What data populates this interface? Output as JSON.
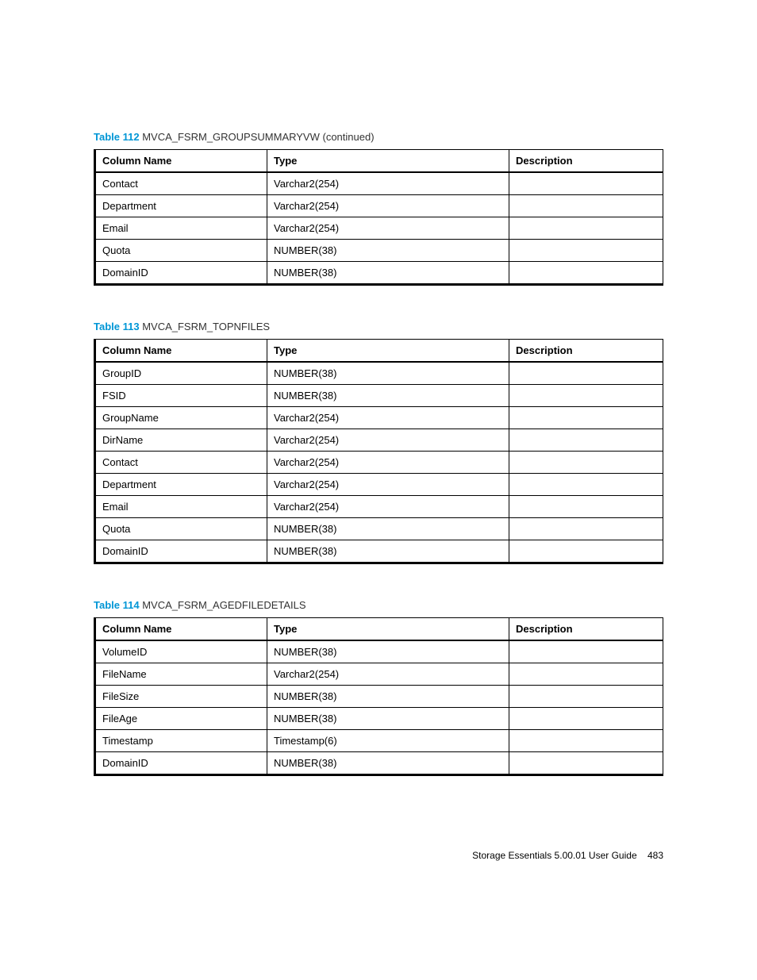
{
  "tables": [
    {
      "number": "Table 112",
      "title": "MVCA_FSRM_GROUPSUMMARYVW (continued)",
      "headers": {
        "col1": "Column Name",
        "col2": "Type",
        "col3": "Description"
      },
      "rows": [
        {
          "name": "Contact",
          "type": "Varchar2(254)",
          "desc": ""
        },
        {
          "name": "Department",
          "type": "Varchar2(254)",
          "desc": ""
        },
        {
          "name": "Email",
          "type": "Varchar2(254)",
          "desc": ""
        },
        {
          "name": "Quota",
          "type": "NUMBER(38)",
          "desc": ""
        },
        {
          "name": "DomainID",
          "type": "NUMBER(38)",
          "desc": ""
        }
      ]
    },
    {
      "number": "Table 113",
      "title": "MVCA_FSRM_TOPNFILES",
      "headers": {
        "col1": "Column Name",
        "col2": "Type",
        "col3": "Description"
      },
      "rows": [
        {
          "name": "GroupID",
          "type": "NUMBER(38)",
          "desc": ""
        },
        {
          "name": "FSID",
          "type": "NUMBER(38)",
          "desc": ""
        },
        {
          "name": "GroupName",
          "type": "Varchar2(254)",
          "desc": ""
        },
        {
          "name": "DirName",
          "type": "Varchar2(254)",
          "desc": ""
        },
        {
          "name": "Contact",
          "type": "Varchar2(254)",
          "desc": ""
        },
        {
          "name": "Department",
          "type": "Varchar2(254)",
          "desc": ""
        },
        {
          "name": "Email",
          "type": "Varchar2(254)",
          "desc": ""
        },
        {
          "name": "Quota",
          "type": "NUMBER(38)",
          "desc": ""
        },
        {
          "name": "DomainID",
          "type": "NUMBER(38)",
          "desc": ""
        }
      ]
    },
    {
      "number": "Table 114",
      "title": "MVCA_FSRM_AGEDFILEDETAILS",
      "headers": {
        "col1": "Column Name",
        "col2": "Type",
        "col3": "Description"
      },
      "rows": [
        {
          "name": "VolumeID",
          "type": "NUMBER(38)",
          "desc": ""
        },
        {
          "name": "FileName",
          "type": "Varchar2(254)",
          "desc": ""
        },
        {
          "name": "FileSize",
          "type": "NUMBER(38)",
          "desc": ""
        },
        {
          "name": "FileAge",
          "type": "NUMBER(38)",
          "desc": ""
        },
        {
          "name": "Timestamp",
          "type": "Timestamp(6)",
          "desc": ""
        },
        {
          "name": "DomainID",
          "type": "NUMBER(38)",
          "desc": ""
        }
      ]
    }
  ],
  "footer": {
    "text": "Storage Essentials 5.00.01 User Guide",
    "page": "483"
  }
}
